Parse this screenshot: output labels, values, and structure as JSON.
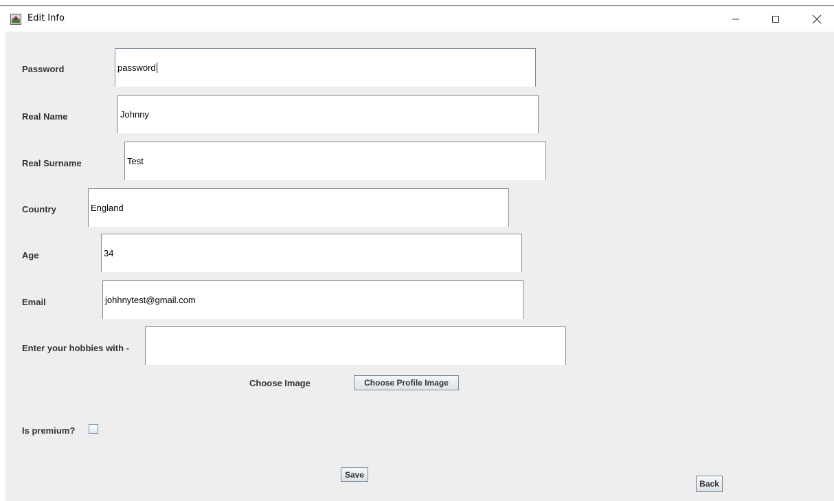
{
  "window": {
    "title": "Edit Info",
    "icon": "java-app-icon",
    "controls": [
      "minimize",
      "maximize",
      "close"
    ]
  },
  "form": {
    "password": {
      "label": "Password",
      "value": "password"
    },
    "real_name": {
      "label": "Real Name",
      "value": "Johnny"
    },
    "real_surname": {
      "label": "Real Surname",
      "value": "Test"
    },
    "country": {
      "label": "Country",
      "value": "England"
    },
    "age": {
      "label": "Age",
      "value": "34"
    },
    "email": {
      "label": "Email",
      "value": "johhnytest@gmail.com"
    },
    "hobbies": {
      "label": "Enter your hobbies with -",
      "value": ""
    },
    "image": {
      "label": "Choose Image",
      "button_label": "Choose Profile Image"
    },
    "premium": {
      "label": "Is premium?",
      "checked": false
    }
  },
  "actions": {
    "save_label": "Save",
    "back_label": "Back"
  }
}
